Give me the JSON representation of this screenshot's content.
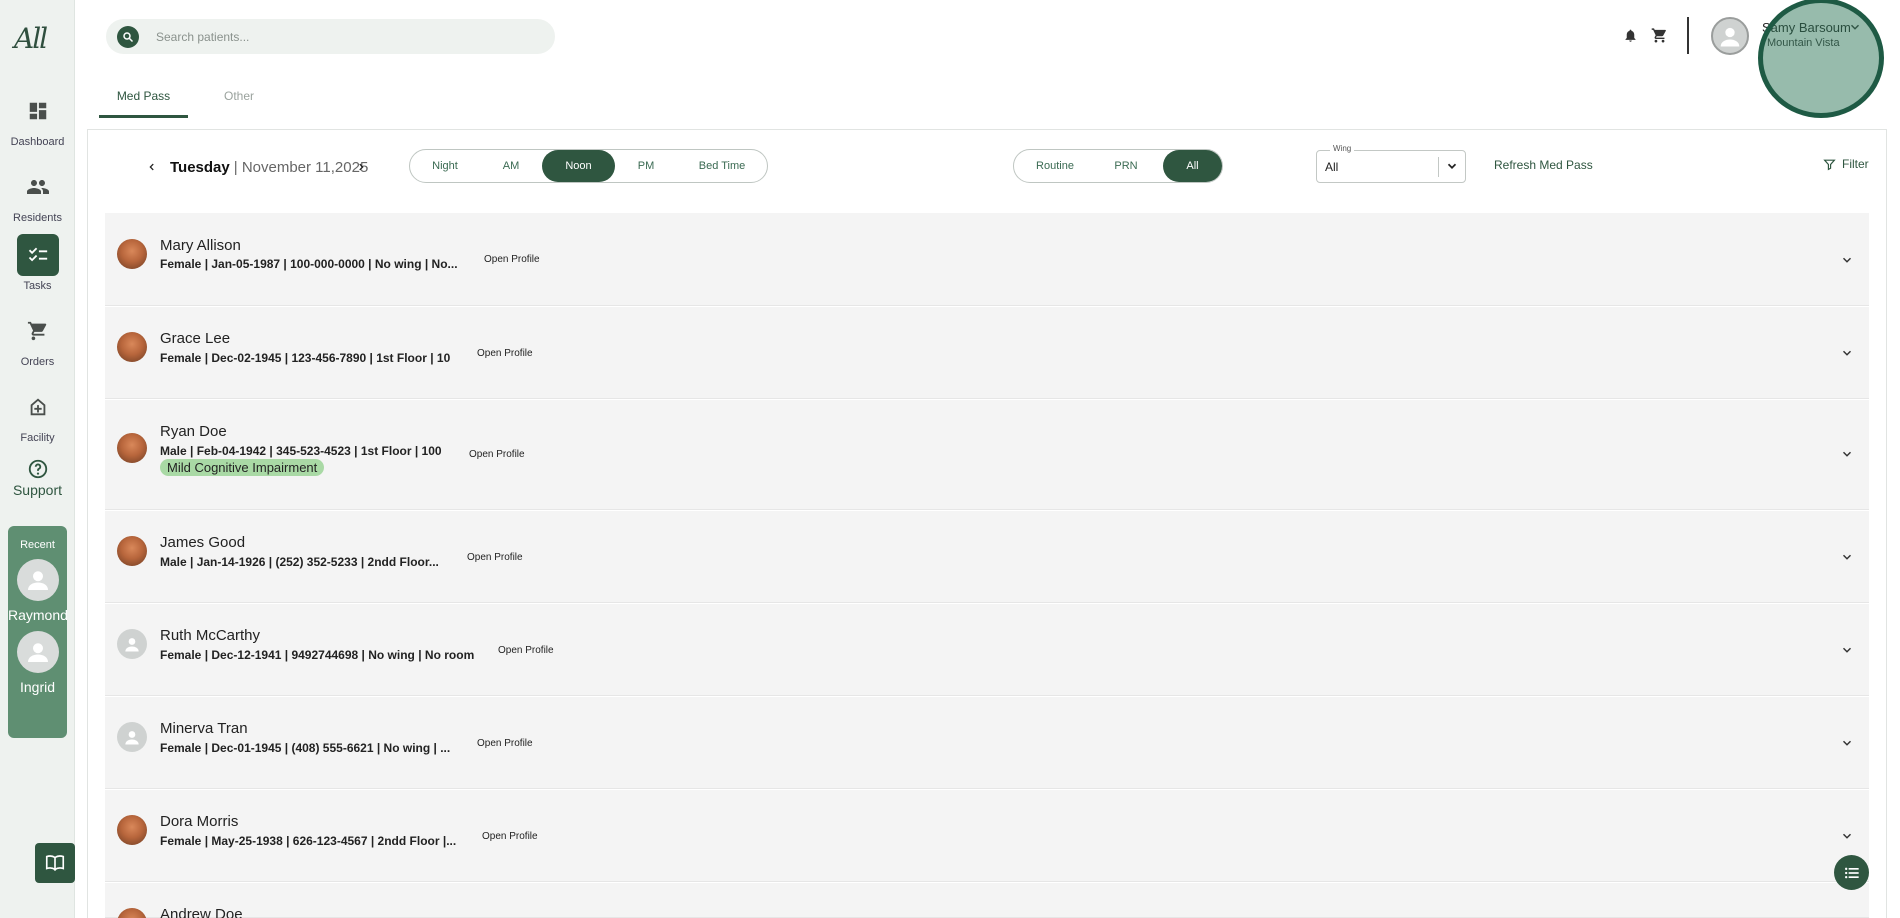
{
  "app": {
    "logo_text": "All"
  },
  "sidebar": {
    "items": [
      {
        "label": "Dashboard",
        "icon": "dashboard-icon"
      },
      {
        "label": "Residents",
        "icon": "people-icon"
      },
      {
        "label": "Tasks",
        "icon": "checklist-icon",
        "active": true
      },
      {
        "label": "Orders",
        "icon": "cart-icon"
      },
      {
        "label": "Facility",
        "icon": "facility-icon"
      }
    ],
    "support_label": "Support",
    "recent": {
      "title": "Recent",
      "people": [
        "Raymond",
        "Ingrid"
      ]
    }
  },
  "header": {
    "search_placeholder": "Search patients...",
    "user_name": "Samy Barsoum",
    "facility": "Mountain Vista"
  },
  "tabs": [
    {
      "label": "Med Pass",
      "active": true
    },
    {
      "label": "Other",
      "active": false
    }
  ],
  "toolbar": {
    "day": "Tuesday",
    "date": "| November 11,2025",
    "time_slots": [
      "Night",
      "AM",
      "Noon",
      "PM",
      "Bed Time"
    ],
    "time_active": "Noon",
    "types": [
      "Routine",
      "PRN",
      "All"
    ],
    "type_active": "All",
    "wing_label": "Wing",
    "wing_value": "All",
    "refresh_label": "Refresh Med Pass",
    "filter_label": "Filter"
  },
  "residents": [
    {
      "name": "Mary Allison",
      "meta": "Female | Jan-05-1987 | 100-000-0000 | No wing | No...",
      "photo": true,
      "open": "Open Profile"
    },
    {
      "name": "Grace Lee",
      "meta": "Female | Dec-02-1945 | 123-456-7890 | 1st Floor | 10",
      "photo": true,
      "open": "Open Profile"
    },
    {
      "name": "Ryan Doe",
      "meta": "Male | Feb-04-1942 | 345-523-4523 | 1st Floor | 100",
      "photo": true,
      "open": "Open Profile",
      "tag": "Mild Cognitive Impairment"
    },
    {
      "name": "James Good",
      "meta": "Male | Jan-14-1926 | (252) 352-5233 | 2ndd Floor...",
      "photo": true,
      "open": "Open Profile"
    },
    {
      "name": "Ruth McCarthy",
      "meta": "Female | Dec-12-1941 | 9492744698 | No wing | No room",
      "photo": false,
      "open": "Open Profile"
    },
    {
      "name": "Minerva Tran",
      "meta": "Female | Dec-01-1945 | (408) 555-6621 | No wing | ...",
      "photo": false,
      "open": "Open Profile"
    },
    {
      "name": "Dora Morris",
      "meta": "Female | May-25-1938 | 626-123-4567 | 2ndd Floor |...",
      "photo": true,
      "open": "Open Profile"
    },
    {
      "name": "Andrew Doe",
      "meta": "",
      "photo": true,
      "open": ""
    }
  ],
  "colors": {
    "primary": "#2f5640",
    "sidebar_bg": "#eef2ef",
    "recent_bg": "#5f8f72",
    "tag_bg": "#a9d9a5",
    "row_bg": "#f4f4f4"
  }
}
